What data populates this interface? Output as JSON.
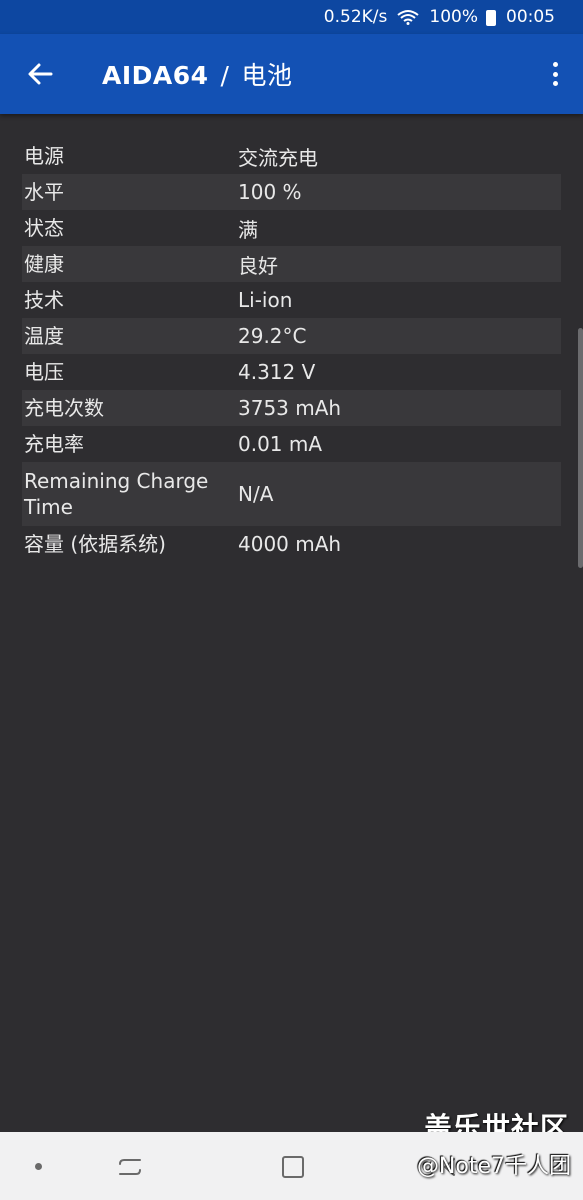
{
  "status_bar": {
    "speed": "0.52K/s",
    "battery": "100%",
    "time": "00:05"
  },
  "app_bar": {
    "app_name": "AIDA64",
    "separator": "/",
    "section": "电池"
  },
  "battery_info": [
    {
      "label": "电源",
      "value": "交流充电"
    },
    {
      "label": "水平",
      "value": "100 %"
    },
    {
      "label": "状态",
      "value": "满"
    },
    {
      "label": "健康",
      "value": "良好"
    },
    {
      "label": "技术",
      "value": "Li-ion"
    },
    {
      "label": "温度",
      "value": "29.2°C"
    },
    {
      "label": "电压",
      "value": "4.312 V"
    },
    {
      "label": "充电次数",
      "value": "3753 mAh"
    },
    {
      "label": "充电率",
      "value": "0.01 mA"
    },
    {
      "label": "Remaining Charge Time",
      "value": "N/A"
    },
    {
      "label": "容量 (依据系统)",
      "value": "4000 mAh"
    }
  ],
  "watermark": {
    "line1": "盖乐世社区",
    "line2": "@Note7千人团"
  },
  "colors": {
    "app_bar": "#1351b4",
    "status_bar": "#0d47a1",
    "background": "#2e2d30",
    "row_alt": "#39383b",
    "nav_bar": "#f1f1f2"
  }
}
